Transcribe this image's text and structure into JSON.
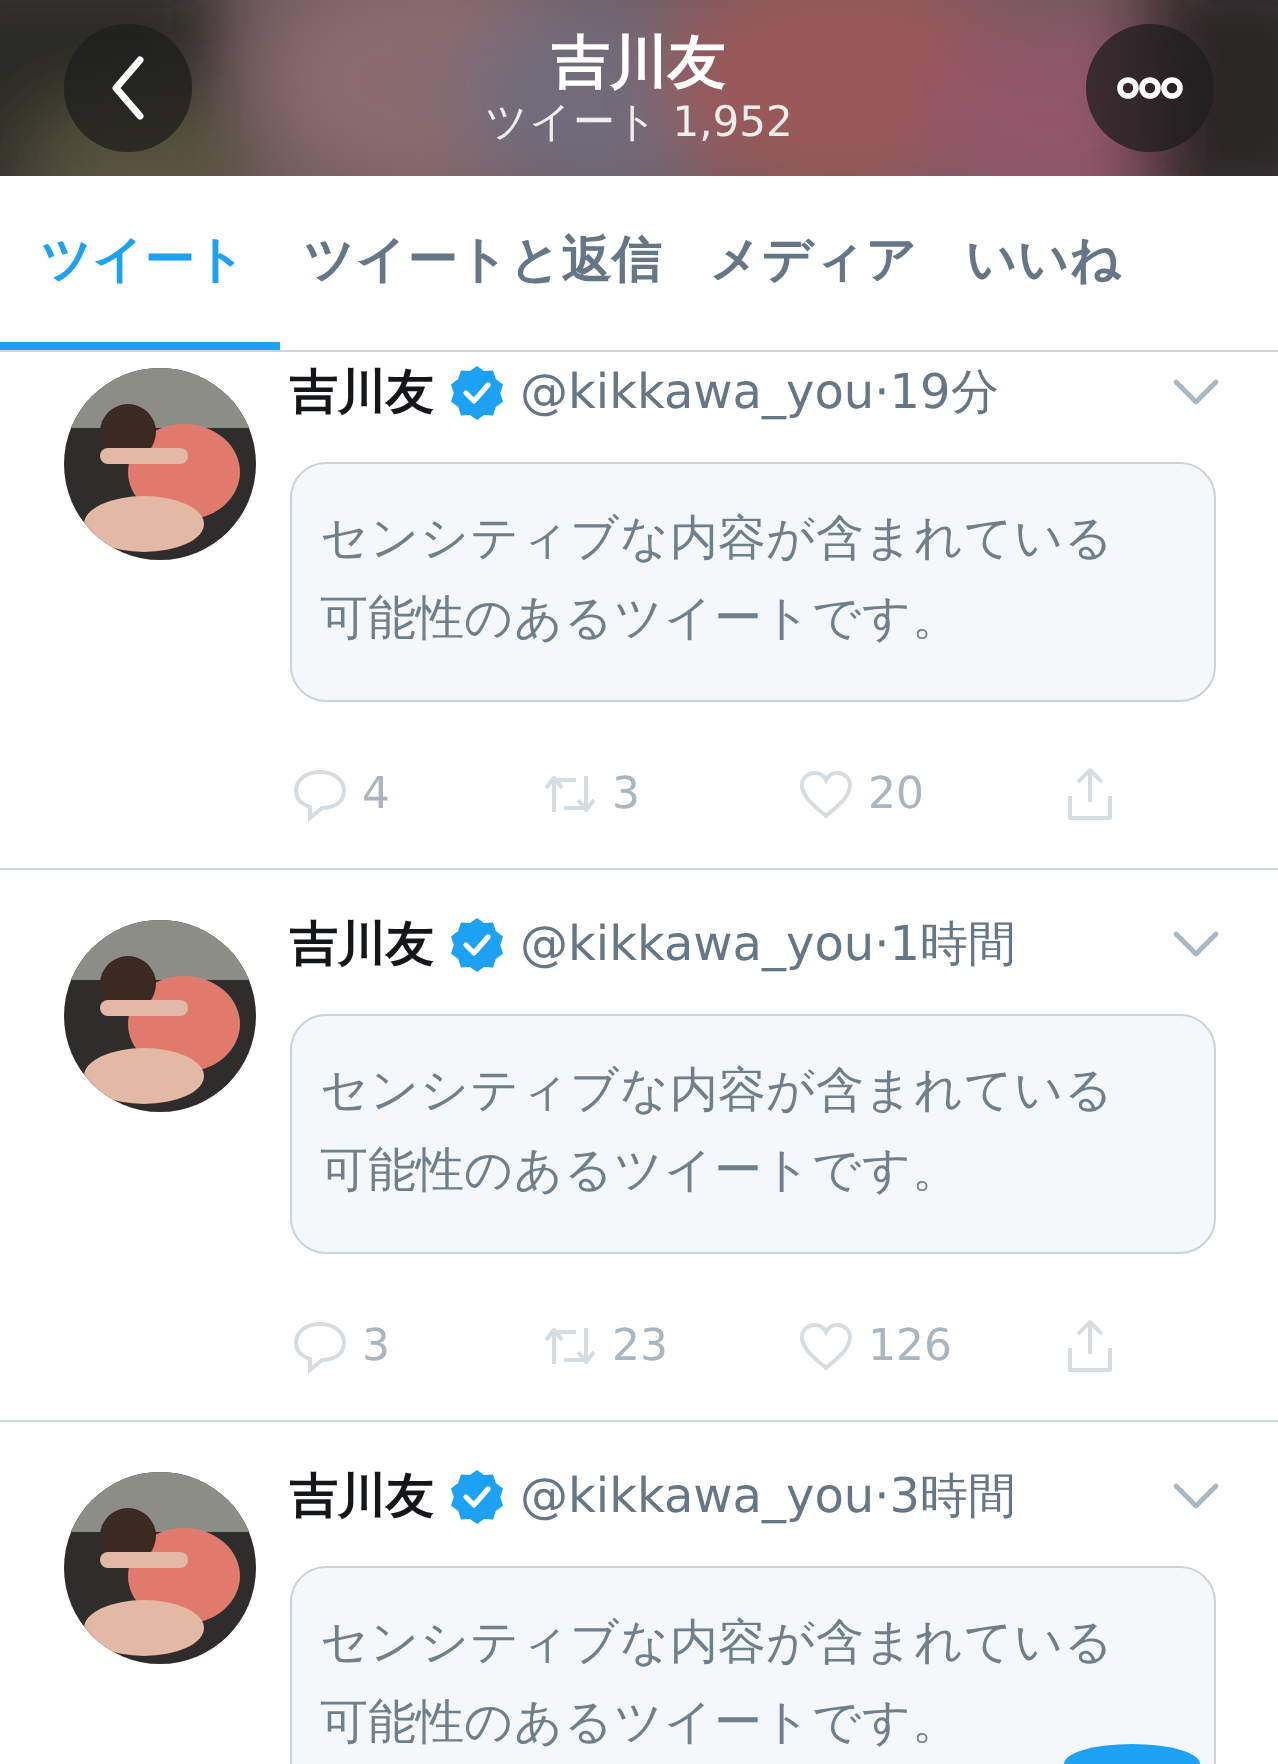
{
  "header": {
    "title": "吉川友",
    "subtitle": "ツイート 1,952"
  },
  "tabs": [
    {
      "label": "ツイート",
      "selected": true
    },
    {
      "label": "ツイートと返信",
      "selected": false
    },
    {
      "label": "メディア",
      "selected": false
    },
    {
      "label": "いいね",
      "selected": false
    }
  ],
  "tweets": [
    {
      "name": "吉川友",
      "verified": true,
      "handle": "@kikkawa_you",
      "time": "·19分",
      "notice": "センシティブな内容が含まれている可能性のあるツイートです。",
      "replies": "4",
      "retweets": "3",
      "likes": "20"
    },
    {
      "name": "吉川友",
      "verified": true,
      "handle": "@kikkawa_you",
      "time": "·1時間",
      "notice": "センシティブな内容が含まれている可能性のあるツイートです。",
      "replies": "3",
      "retweets": "23",
      "likes": "126"
    },
    {
      "name": "吉川友",
      "verified": true,
      "handle": "@kikkawa_you",
      "time": "·3時間",
      "notice": "センシティブな内容が含まれている可能性のあるツイートです。"
    }
  ]
}
